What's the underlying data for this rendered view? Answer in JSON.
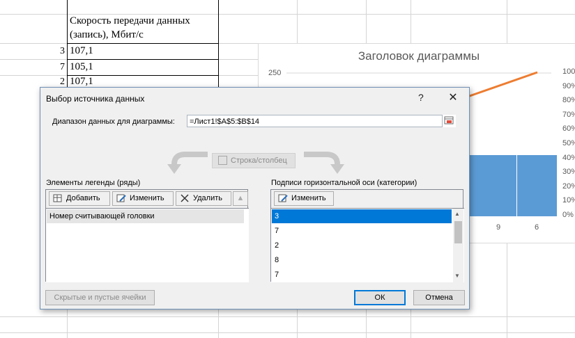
{
  "sheet": {
    "header_line1": "Скорость передачи данных",
    "header_line2": "(запись), Мбит/с",
    "rows": [
      {
        "a": "3",
        "b": "107,1"
      },
      {
        "a": "7",
        "b": "105,1"
      },
      {
        "a": "2",
        "b": "107,1"
      }
    ]
  },
  "chart": {
    "title": "Заголовок диаграммы",
    "y_left_top": "250",
    "y_right_ticks": [
      "100%",
      "90%",
      "80%",
      "70%",
      "60%",
      "50%",
      "40%",
      "30%",
      "20%",
      "10%",
      "0%"
    ],
    "x_ticks": [
      "9",
      "6"
    ]
  },
  "chart_data": {
    "type": "bar",
    "title": "Заголовок диаграммы",
    "categories": [
      "9",
      "6"
    ],
    "y_right_ticks": [
      "0%",
      "10%",
      "20%",
      "30%",
      "40%",
      "50%",
      "60%",
      "70%",
      "80%",
      "90%",
      "100%"
    ],
    "ylim": [
      0,
      250
    ],
    "colors": {
      "bar": "#5b9bd5",
      "line": "#ed7d31"
    }
  },
  "dialog": {
    "title": "Выбор источника данных",
    "help": "?",
    "close": "✕",
    "range_label": "Диапазон данных для диаграммы:",
    "range_value": "=Лист1!$A$5:$B$14",
    "swap_label": "Строка/столбец",
    "legend_label": "Элементы легенды (ряды)",
    "add_label": "Добавить",
    "edit_label": "Изменить",
    "delete_label": "Удалить",
    "series": [
      "Номер считывающей головки"
    ],
    "axis_label": "Подписи горизонтальной оси (категории)",
    "axis_edit_label": "Изменить",
    "categories": [
      "3",
      "7",
      "2",
      "8",
      "7"
    ],
    "hidden_label": "Скрытые и пустые ячейки",
    "ok_label": "ОК",
    "cancel_label": "Отмена"
  }
}
